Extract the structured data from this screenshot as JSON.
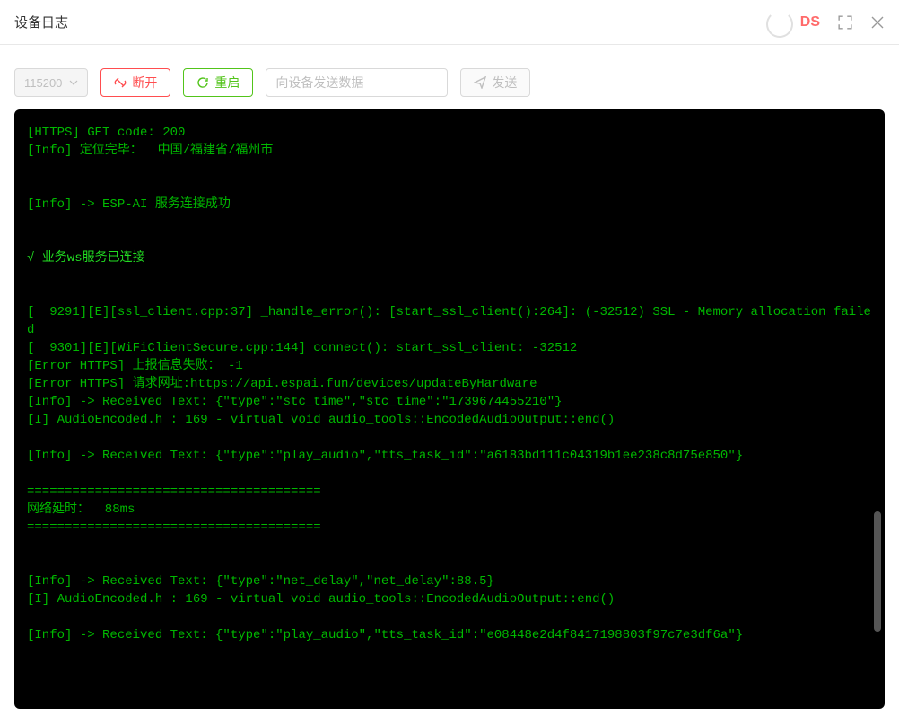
{
  "header": {
    "title": "设备日志",
    "badge": "DS"
  },
  "toolbar": {
    "baud_rate": "115200",
    "disconnect": "断开",
    "reboot": "重启",
    "input_placeholder": "向设备发送数据",
    "send": "发送"
  },
  "log_lines": [
    {
      "cls": "c-green",
      "text": "[HTTPS] GET code: 200"
    },
    {
      "cls": "c-green",
      "text": "[Info] 定位完毕：  中国/福建省/福州市"
    },
    {
      "cls": "c-empty",
      "text": ""
    },
    {
      "cls": "c-empty",
      "text": ""
    },
    {
      "cls": "c-green",
      "text": "[Info] -> ESP-AI 服务连接成功"
    },
    {
      "cls": "c-empty",
      "text": ""
    },
    {
      "cls": "c-empty",
      "text": ""
    },
    {
      "cls": "c-green-bright",
      "text": "√ 业务ws服务已连接"
    },
    {
      "cls": "c-empty",
      "text": ""
    },
    {
      "cls": "c-empty",
      "text": ""
    },
    {
      "cls": "c-green",
      "text": "[  9291][E][ssl_client.cpp:37] _handle_error(): [start_ssl_client():264]: (-32512) SSL - Memory allocation failed"
    },
    {
      "cls": "c-green",
      "text": "[  9301][E][WiFiClientSecure.cpp:144] connect(): start_ssl_client: -32512"
    },
    {
      "cls": "c-green",
      "text": "[Error HTTPS] 上报信息失败： -1"
    },
    {
      "cls": "c-green",
      "text": "[Error HTTPS] 请求网址:https://api.espai.fun/devices/updateByHardware"
    },
    {
      "cls": "c-green",
      "text": "[Info] -> Received Text: {\"type\":\"stc_time\",\"stc_time\":\"1739674455210\"}"
    },
    {
      "cls": "c-green",
      "text": "[I] AudioEncoded.h : 169 - virtual void audio_tools::EncodedAudioOutput::end()"
    },
    {
      "cls": "c-empty",
      "text": ""
    },
    {
      "cls": "c-green",
      "text": "[Info] -> Received Text: {\"type\":\"play_audio\",\"tts_task_id\":\"a6183bd111c04319b1ee238c8d75e850\"}"
    },
    {
      "cls": "c-empty",
      "text": ""
    },
    {
      "cls": "c-green",
      "text": "======================================="
    },
    {
      "cls": "c-green",
      "text": "网络延时：  88ms"
    },
    {
      "cls": "c-green",
      "text": "======================================="
    },
    {
      "cls": "c-empty",
      "text": ""
    },
    {
      "cls": "c-empty",
      "text": ""
    },
    {
      "cls": "c-green",
      "text": "[Info] -> Received Text: {\"type\":\"net_delay\",\"net_delay\":88.5}"
    },
    {
      "cls": "c-green",
      "text": "[I] AudioEncoded.h : 169 - virtual void audio_tools::EncodedAudioOutput::end()"
    },
    {
      "cls": "c-empty",
      "text": ""
    },
    {
      "cls": "c-green",
      "text": "[Info] -> Received Text: {\"type\":\"play_audio\",\"tts_task_id\":\"e08448e2d4f8417198803f97c7e3df6a\"}"
    }
  ]
}
